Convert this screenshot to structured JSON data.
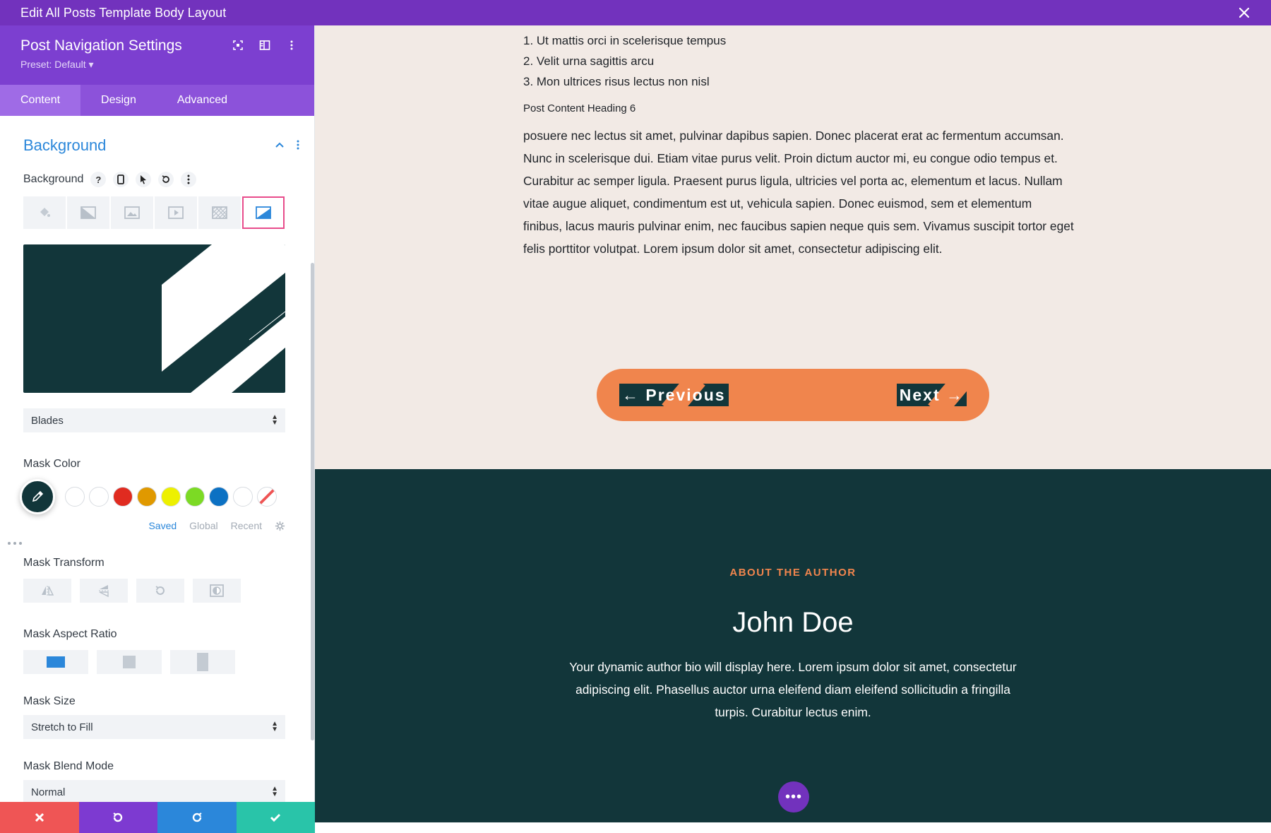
{
  "window": {
    "title": "Edit All Posts Template Body Layout"
  },
  "panel": {
    "title": "Post Navigation Settings",
    "preset": "Preset: Default ▾",
    "tabs": [
      "Content",
      "Design",
      "Advanced"
    ],
    "active_tab": "Content"
  },
  "section": {
    "title": "Background",
    "background_label": "Background",
    "help_glyph": "?",
    "mask_select": "Blades",
    "mask_color_label": "Mask Color",
    "palette_tabs": [
      "Saved",
      "Global",
      "Recent"
    ],
    "swatches": [
      "#ffffff",
      "#ffffff",
      "#e02b20",
      "#e09900",
      "#edf000",
      "#7cda24",
      "#0c71c3",
      "#ffffff"
    ],
    "mask_transform_label": "Mask Transform",
    "mask_aspect_label": "Mask Aspect Ratio",
    "mask_size_label": "Mask Size",
    "mask_size_value": "Stretch to Fill",
    "mask_blend_label": "Mask Blend Mode",
    "mask_blend_value": "Normal"
  },
  "content": {
    "list": [
      "1. Ut mattis orci in scelerisque tempus",
      "2. Velit urna sagittis arcu",
      "3. Mon ultrices risus lectus non nisl"
    ],
    "heading6": "Post Content Heading 6",
    "body": "posuere nec lectus sit amet, pulvinar dapibus sapien. Donec placerat erat ac fermentum accumsan. Nunc in scelerisque dui. Etiam vitae purus velit. Proin dictum auctor mi, eu congue odio tempus et. Curabitur ac semper ligula. Praesent purus ligula, ultricies vel porta ac, elementum et lacus. Nullam vitae augue aliquet, condimentum est ut, vehicula sapien. Donec euismod, sem et elementum finibus, lacus mauris pulvinar enim, nec faucibus sapien neque quis sem. Vivamus suscipit tortor eget felis porttitor volutpat. Lorem ipsum dolor sit amet, consectetur adipiscing elit."
  },
  "postnav": {
    "previous": "← Previous",
    "next": "Next →"
  },
  "author": {
    "eyebrow": "ABOUT THE AUTHOR",
    "name": "John Doe",
    "bio": "Your dynamic author bio will display here. Lorem ipsum dolor sit amet, consectetur adipiscing elit. Phasellus auctor urna eleifend diam eleifend sollicitudin a fringilla turpis. Curabitur lectus enim."
  },
  "colors": {
    "topbar": "#7232bd",
    "panel_head": "#7c3fd0",
    "accent_blue": "#2b87da",
    "dark_teal": "#12363a",
    "orange": "#f0854d",
    "footer": [
      "#ef5555",
      "#7d3ad1",
      "#2b87da",
      "#29c4a9"
    ]
  }
}
